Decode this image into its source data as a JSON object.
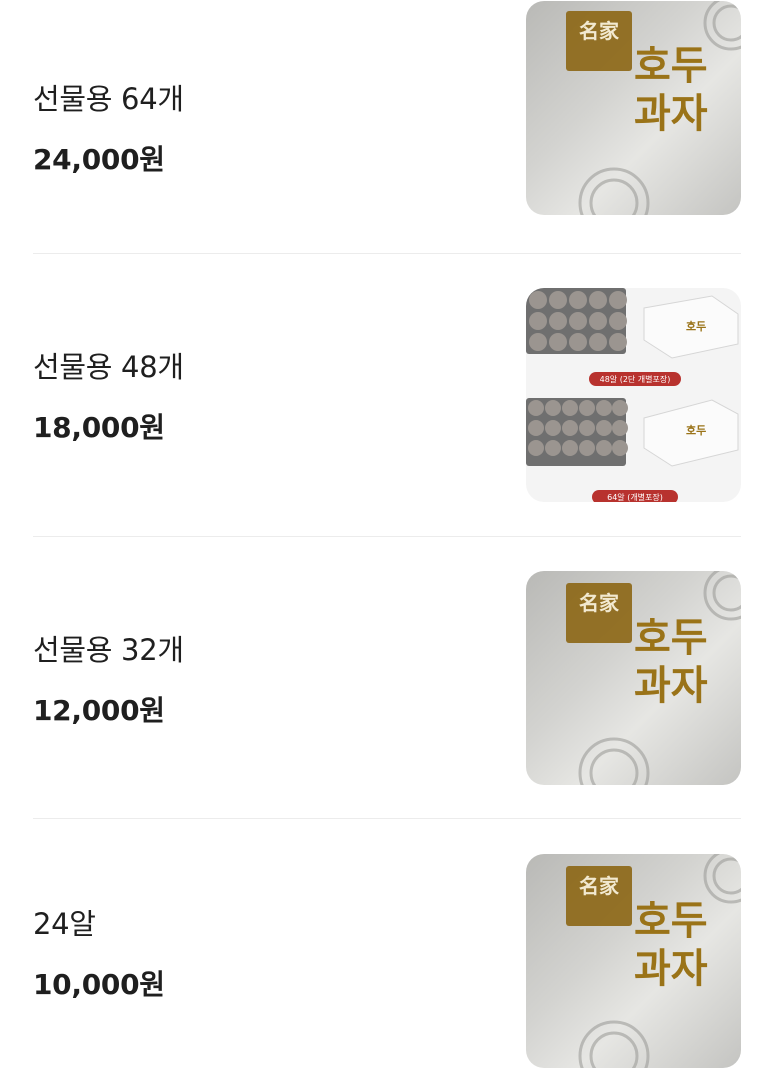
{
  "products": [
    {
      "name": "선물용 64개",
      "price": "24,000원",
      "image_icon": "walnut-cake-box-image",
      "image_text": [
        "名家",
        "호두",
        "과자"
      ]
    },
    {
      "name": "선물용 48개",
      "price": "18,000원",
      "image_icon": "walnut-cake-package-photo",
      "image_captions": [
        "48알 (2단 개별포장)",
        "64알 (개별포장)"
      ]
    },
    {
      "name": "선물용 32개",
      "price": "12,000원",
      "image_icon": "walnut-cake-box-image",
      "image_text": [
        "名家",
        "호두",
        "과자"
      ]
    },
    {
      "name": "24알",
      "price": "10,000원",
      "image_icon": "walnut-cake-box-image",
      "image_text": [
        "名家",
        "호두",
        "과자"
      ]
    }
  ],
  "colors": {
    "text": "#1f1f1f",
    "divider": "#ececec",
    "logo_gold": "#9a7318",
    "caption_red": "#b8322e"
  }
}
